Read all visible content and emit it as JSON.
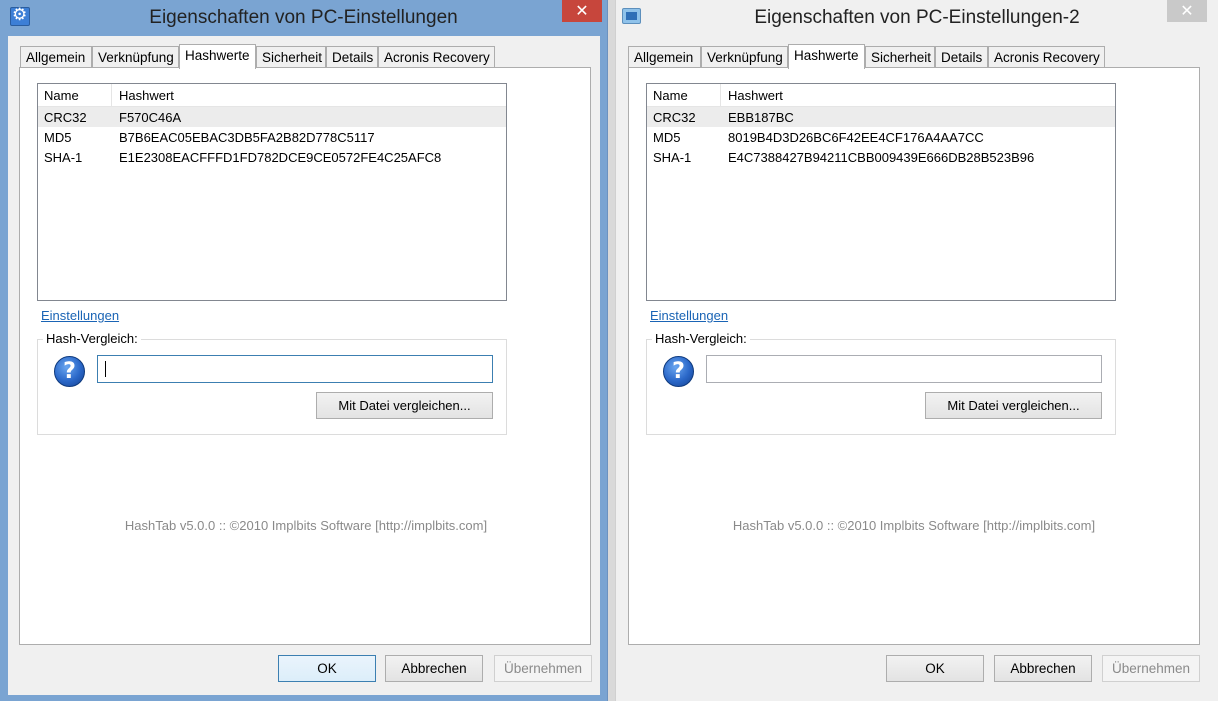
{
  "windows": [
    {
      "title": "Eigenschaften von PC-Einstellungen",
      "tabs": [
        "Allgemein",
        "Verknüpfung",
        "Hashwerte",
        "Sicherheit",
        "Details",
        "Acronis Recovery"
      ],
      "active_tab": "Hashwerte",
      "list": {
        "headers": [
          "Name",
          "Hashwert"
        ],
        "rows": [
          {
            "name": "CRC32",
            "value": "F570C46A"
          },
          {
            "name": "MD5",
            "value": "B7B6EAC05EBAC3DB5FA2B82D778C5117"
          },
          {
            "name": "SHA-1",
            "value": "E1E2308EACFFFD1FD782DCE9CE0572FE4C25AFC8"
          }
        ],
        "selected_row": 0
      },
      "settings_link": "Einstellungen",
      "compare": {
        "label": "Hash-Vergleich:",
        "input_value": "",
        "button": "Mit Datei vergleichen..."
      },
      "footer": "HashTab v5.0.0 :: ©2010 Implbits Software [http://implbits.com]",
      "buttons": {
        "ok": "OK",
        "cancel": "Abbrechen",
        "apply": "Übernehmen"
      }
    },
    {
      "title": "Eigenschaften von PC-Einstellungen-2",
      "tabs": [
        "Allgemein",
        "Verknüpfung",
        "Hashwerte",
        "Sicherheit",
        "Details",
        "Acronis Recovery"
      ],
      "active_tab": "Hashwerte",
      "list": {
        "headers": [
          "Name",
          "Hashwert"
        ],
        "rows": [
          {
            "name": "CRC32",
            "value": "EBB187BC"
          },
          {
            "name": "MD5",
            "value": "8019B4D3D26BC6F42EE4CF176A4AA7CC"
          },
          {
            "name": "SHA-1",
            "value": "E4C7388427B94211CBB009439E666DB28B523B96"
          }
        ],
        "selected_row": 0
      },
      "settings_link": "Einstellungen",
      "compare": {
        "label": "Hash-Vergleich:",
        "input_value": "",
        "button": "Mit Datei vergleichen..."
      },
      "footer": "HashTab v5.0.0 :: ©2010 Implbits Software [http://implbits.com]",
      "buttons": {
        "ok": "OK",
        "cancel": "Abbrechen",
        "apply": "Übernehmen"
      }
    }
  ],
  "icons": {
    "close": "close-icon",
    "help": "question-icon",
    "app_left": "gear-app-icon",
    "app_right": "monitor-app-icon"
  },
  "colors": {
    "active_titlebar": "#7aa4d2",
    "inactive_titlebar": "#f0f0f0",
    "close_active": "#c7463c",
    "link": "#1a64b5"
  }
}
